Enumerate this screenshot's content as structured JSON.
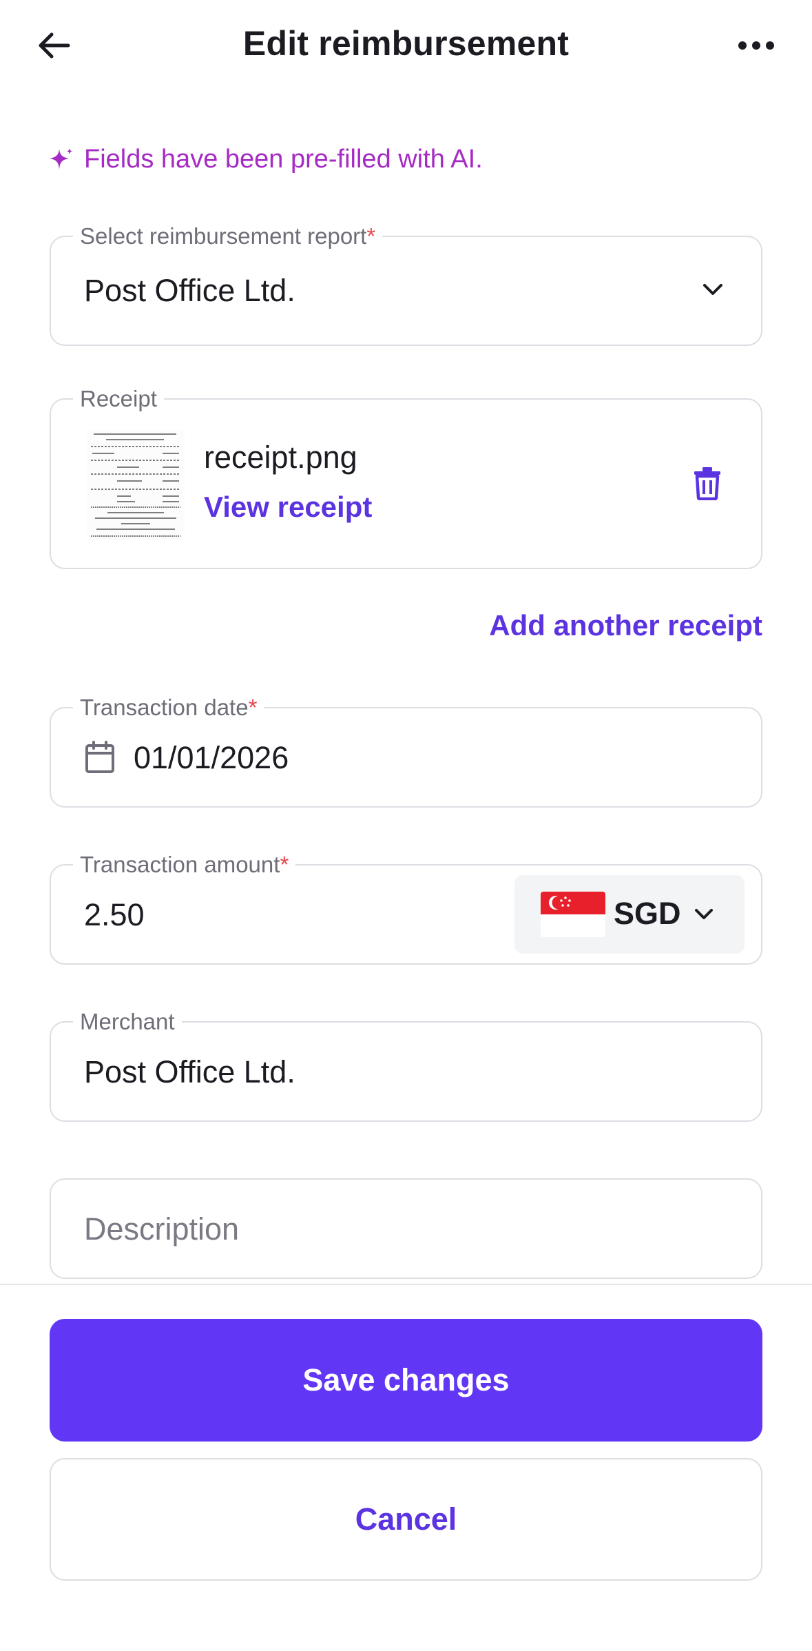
{
  "header": {
    "title": "Edit reimbursement",
    "back_icon": "arrow-left-icon",
    "more_icon": "more-horizontal-icon"
  },
  "ai_notice": {
    "icon": "sparkle-icon",
    "text": "Fields have been pre-filled with AI."
  },
  "report_field": {
    "label": "Select reimbursement report",
    "required_mark": "*",
    "value": "Post Office Ltd."
  },
  "receipt_field": {
    "label": "Receipt",
    "file_name": "receipt.png",
    "view_link": "View receipt",
    "delete_icon": "trash-icon"
  },
  "add_receipt_link": "Add another receipt",
  "date_field": {
    "label": "Transaction date",
    "required_mark": "*",
    "value": "01/01/2026",
    "icon": "calendar-icon"
  },
  "amount_field": {
    "label": "Transaction amount",
    "required_mark": "*",
    "value": "2.50",
    "currency_code": "SGD",
    "currency_flag": "singapore-flag-icon"
  },
  "merchant_field": {
    "label": "Merchant",
    "value": "Post Office Ltd."
  },
  "description_field": {
    "placeholder": "Description",
    "value": ""
  },
  "actions": {
    "save_label": "Save changes",
    "cancel_label": "Cancel"
  },
  "colors": {
    "accent": "#6236f5",
    "link": "#5b33e0",
    "ai": "#a62ac4",
    "required": "#e5484d",
    "border": "#dddde3"
  }
}
